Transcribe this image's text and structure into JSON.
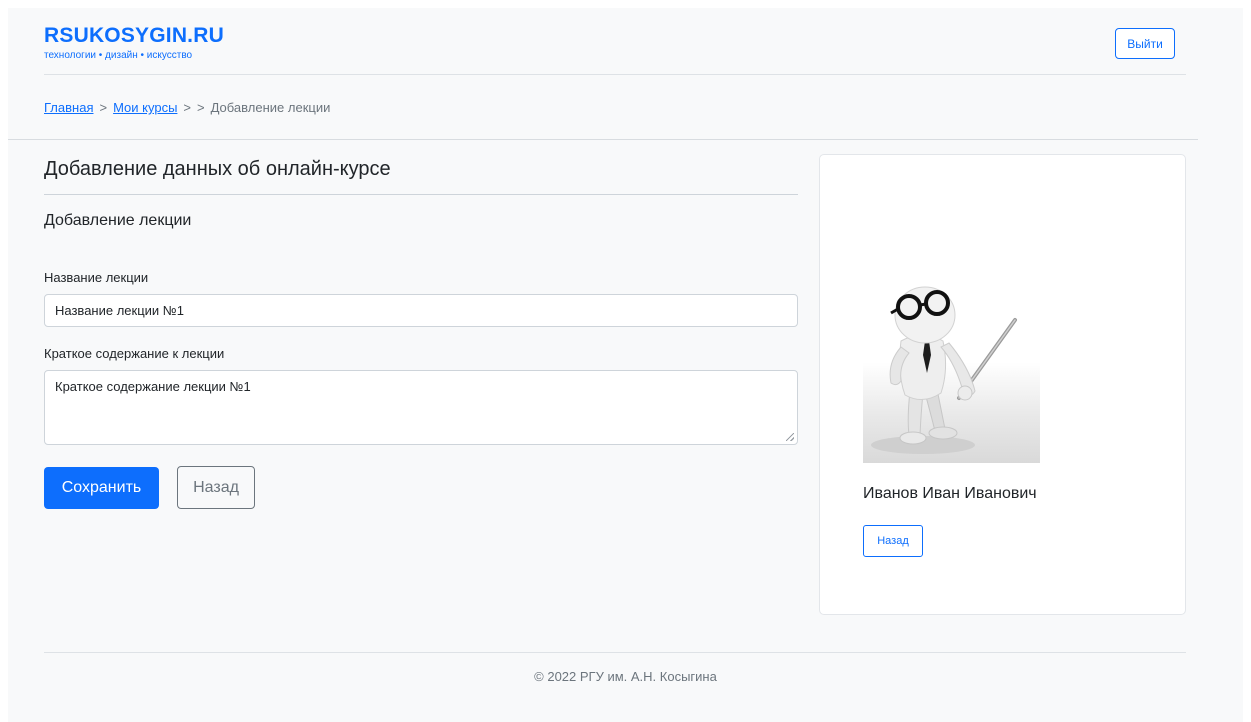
{
  "header": {
    "brand_title": "RSUKOSYGIN.RU",
    "brand_subtitle": "технологии • дизайн • искусство",
    "logout_label": "Выйти"
  },
  "breadcrumb": {
    "home": "Главная",
    "sep1": ">",
    "my_courses": "Мои курсы",
    "sep2": ">",
    "sep3": ">",
    "current": "Добавление лекции"
  },
  "main": {
    "title": "Добавление данных об онлайн-курсе",
    "subtitle": "Добавление лекции",
    "name_label": "Название лекции",
    "name_value": "Название лекции №1",
    "summary_label": "Краткое содержание к лекции",
    "summary_value": "Краткое содержание лекции №1",
    "save_label": "Сохранить",
    "back_label": "Назад"
  },
  "card": {
    "image_icon": "teacher-with-pointer-illustration",
    "teacher_name": "Иванов Иван Иванович",
    "back_label": "Назад"
  },
  "footer": {
    "copyright": "© 2022 РГУ им. А.Н. Косыгина"
  },
  "colors": {
    "accent": "#0d6efd",
    "secondary": "#6c757d",
    "page_bg": "#f8f9fa"
  }
}
